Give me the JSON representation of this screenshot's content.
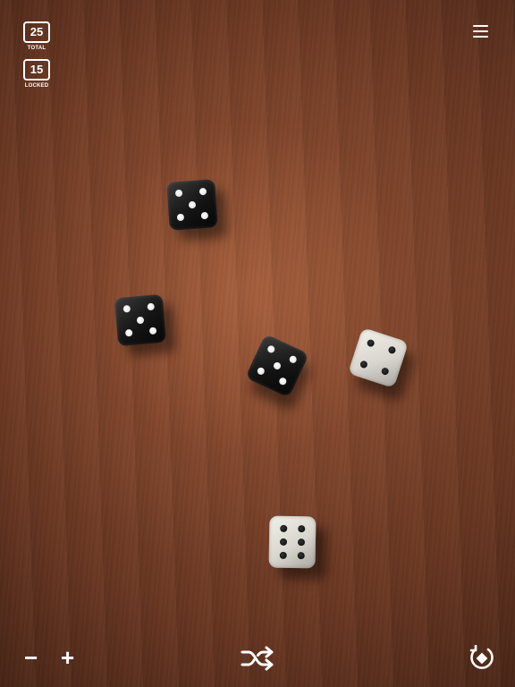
{
  "counters": {
    "total": {
      "value": "25",
      "label": "TOTAL"
    },
    "locked": {
      "value": "15",
      "label": "LOCKED"
    }
  },
  "dice": [
    {
      "color": "black",
      "value": 5
    },
    {
      "color": "black",
      "value": 5
    },
    {
      "color": "black",
      "value": 5
    },
    {
      "color": "white",
      "value": 4
    },
    {
      "color": "white",
      "value": 6
    }
  ],
  "controls": {
    "minus_label": "−",
    "plus_label": "+",
    "icons": [
      "menu-icon",
      "shuffle-icon",
      "roll-icon"
    ]
  },
  "colors": {
    "ui_foreground": "#ffffff",
    "table": "#6a3722"
  }
}
